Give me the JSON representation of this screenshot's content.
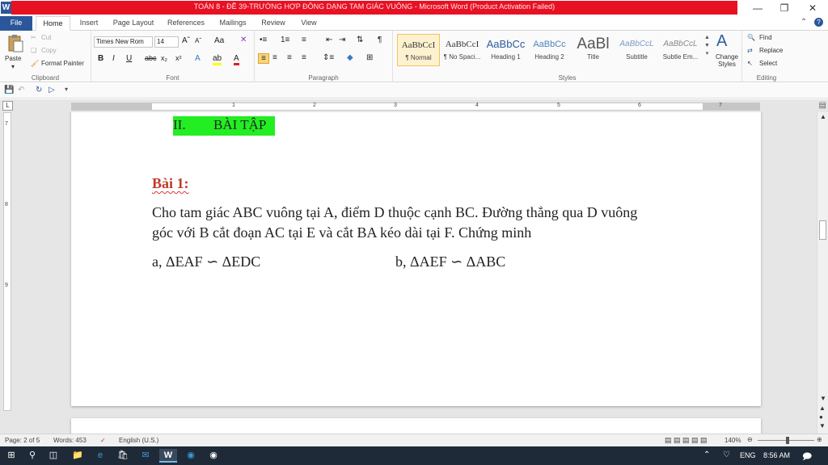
{
  "window": {
    "title": "TOÁN 8 - ĐỀ 39-TRƯỜNG HỢP ĐỒNG DẠNG TAM GIÁC VUÔNG - Microsoft Word (Product Activation Failed)",
    "app_letter": "W"
  },
  "tabs": {
    "file": "File",
    "home": "Home",
    "insert": "Insert",
    "page_layout": "Page Layout",
    "references": "References",
    "mailings": "Mailings",
    "review": "Review",
    "view": "View"
  },
  "clipboard": {
    "paste": "Paste",
    "cut": "Cut",
    "copy": "Copy",
    "format_painter": "Format Painter",
    "label": "Clipboard"
  },
  "font": {
    "name": "Times New Rom",
    "size": "14",
    "label": "Font"
  },
  "paragraph": {
    "label": "Paragraph"
  },
  "styles": {
    "label": "Styles",
    "items": [
      {
        "preview": "AaBbCcI",
        "name": "¶ Normal"
      },
      {
        "preview": "AaBbCcI",
        "name": "¶ No Spaci..."
      },
      {
        "preview": "AaBbCc",
        "name": "Heading 1"
      },
      {
        "preview": "AaBbCc",
        "name": "Heading 2"
      },
      {
        "preview": "AaBl",
        "name": "Title"
      },
      {
        "preview": "AaBbCcL",
        "name": "Subtitle"
      },
      {
        "preview": "AaBbCcL",
        "name": "Subtle Em..."
      }
    ],
    "change_styles": "Change Styles"
  },
  "editing": {
    "find": "Find",
    "replace": "Replace",
    "select": "Select",
    "label": "Editing"
  },
  "document": {
    "heading_num": "II.",
    "heading_text": "BÀI TẬP",
    "exercise_title": "Bài 1:",
    "line1": "Cho tam giác ABC vuông tại A, điểm D thuộc cạnh BC. Đường thẳng qua D vuông",
    "line2": "góc với B cắt đoạn AC tại E và cắt BA kéo dài tại F. Chứng minh",
    "part_a": "a, ΔEAF ∽ ΔEDC",
    "part_b": "b, ΔAEF ∽ ΔABC"
  },
  "ruler": {
    "numbers": [
      "1",
      "2",
      "3",
      "4",
      "5",
      "6",
      "7"
    ]
  },
  "status": {
    "page": "Page: 2 of 5",
    "words": "Words: 453",
    "language": "English (U.S.)",
    "zoom": "140%"
  },
  "taskbar": {
    "language": "ENG",
    "time": "8:56 AM"
  }
}
